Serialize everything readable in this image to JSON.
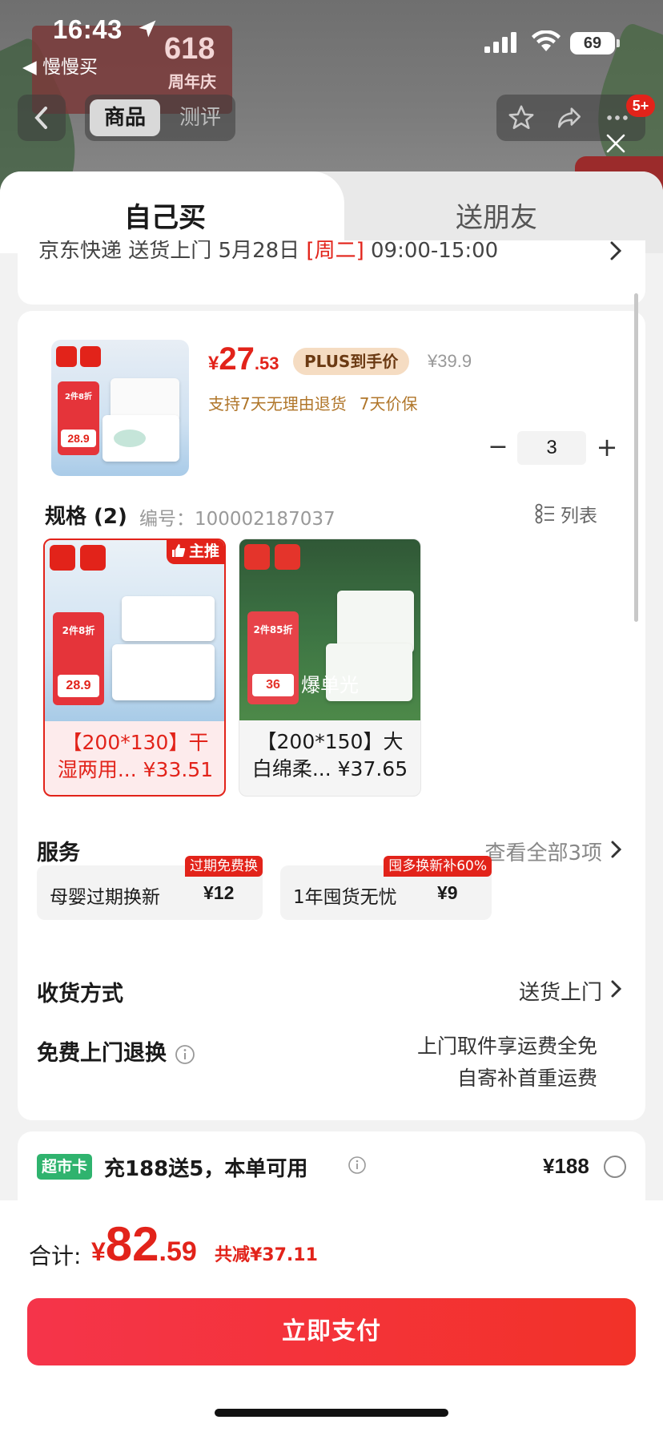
{
  "status_bar": {
    "time": "16:43",
    "back_app": "◀ 慢慢买",
    "battery": "69",
    "icons": [
      "location-arrow-icon",
      "signal-icon",
      "wifi-icon",
      "battery-icon"
    ]
  },
  "background_page": {
    "brand_logo_text": "618",
    "brand_logo_sub": "周年庆",
    "nav_tabs": [
      "商品",
      "测评"
    ],
    "nav_badge": "5+"
  },
  "sheet": {
    "tabs": [
      "自己买",
      "送朋友"
    ],
    "delivery": {
      "prefix": "京东快递 送货上门 5月28日 ",
      "highlight": "[周二]",
      "suffix": " 09:00-15:00"
    },
    "product": {
      "price_currency": "¥",
      "price_int": "27",
      "price_dec": ".53",
      "plus_tag": "PLUS到手价",
      "original_price": "¥39.9",
      "promise_1": "支持7天无理由退货",
      "promise_2": "7天价保",
      "quantity": "3",
      "qty_minus": "−",
      "qty_plus": "+",
      "image_tag_text": "2件8折",
      "image_tag_price": "28.9"
    },
    "spec": {
      "title": "规格 (2)",
      "code_label": "编号：100002187037",
      "list_label": "列表"
    },
    "skus": [
      {
        "name": "【200*130】干湿两用... ¥33.51",
        "badge": "主推",
        "tag_text": "2件8折",
        "tag_price": "28.9",
        "selected": true
      },
      {
        "name": "【200*150】大白绵柔... ¥37.65",
        "overlay": "爆单光",
        "tag_text": "2件85折",
        "tag_price": "36",
        "selected": false
      }
    ],
    "services": {
      "title": "服务",
      "view_all": "查看全部3项",
      "items": [
        {
          "label": "母婴过期换新",
          "price": "¥12",
          "tag": "过期免费换"
        },
        {
          "label": "1年囤货无忧",
          "price": "¥9",
          "tag": "囤多换新补60%"
        }
      ]
    },
    "shipping": {
      "title": "收货方式",
      "value": "送货上门"
    },
    "free_return": {
      "title": "免费上门退换",
      "line_1": "上门取件享运费全免",
      "line_2": "自寄补首重运费"
    },
    "market_card": {
      "tag": "超市卡",
      "text": "充188送5，本单可用",
      "price": "¥188"
    }
  },
  "bottom": {
    "total_label": "合计:",
    "total_currency": "¥",
    "total_int": "82",
    "total_dec": ".59",
    "discount": "共减¥37.11",
    "pay_button": "立即支付"
  },
  "colors": {
    "accent_red": "#e2231a",
    "plus_tag_bg": "#f5dcc2",
    "promise_gold": "#b0762a",
    "market_green": "#2fb36e"
  }
}
